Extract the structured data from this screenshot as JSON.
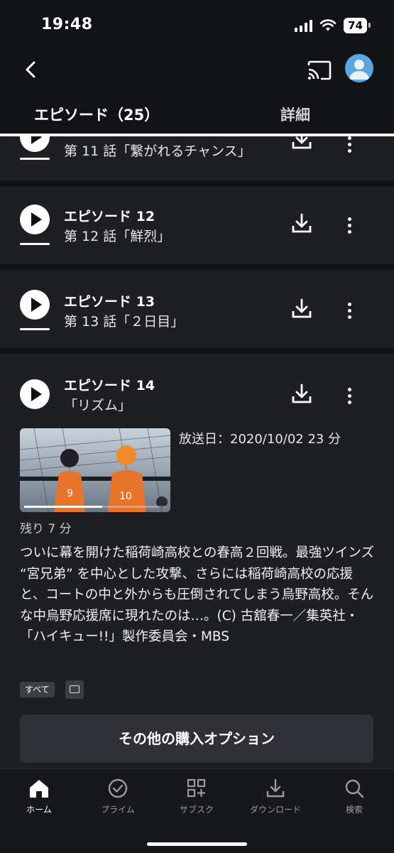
{
  "status_bar": {
    "time": "19:48",
    "battery": "74"
  },
  "tabs": [
    {
      "label": "エピソード（25）",
      "active": true
    },
    {
      "label": "詳細",
      "active": false
    }
  ],
  "episodes": [
    {
      "title": "",
      "subtitle": "第 11 話「繋がれるチャンス」"
    },
    {
      "title": "エピソード 12",
      "subtitle": "第 12 話「鮮烈」"
    },
    {
      "title": "エピソード 13",
      "subtitle": "第 13 話「２日目」"
    },
    {
      "title": "エピソード 14",
      "subtitle": "「リズム」"
    }
  ],
  "expanded": {
    "air_date": "放送日：2020/10/02 23 分",
    "remaining": "残り 7 分",
    "watched_fraction": 0.55,
    "description": "ついに幕を開けた稲荷崎高校との春高２回戦。最強ツインズ “宮兄弟” を中心とした攻撃、さらには稲荷崎高校の応援と、コートの中と外からも圧倒されてしまう烏野高校。そんな中烏野応援席に現れたのは…。(C) 古舘春一／集英社・「ハイキュー!!」製作委員会・MBS",
    "tag_all": "すべて",
    "buy_button": "その他の購入オプション"
  },
  "bottom_nav": [
    {
      "label": "ホーム",
      "icon": "home-icon",
      "active": true
    },
    {
      "label": "プライム",
      "icon": "check-circle-icon",
      "active": false
    },
    {
      "label": "サブスク",
      "icon": "subscriptions-icon",
      "active": false
    },
    {
      "label": "ダウンロード",
      "icon": "download-icon",
      "active": false
    },
    {
      "label": "検索",
      "icon": "search-icon",
      "active": false
    }
  ],
  "colors": {
    "background": "#121316",
    "card": "#1e1f23",
    "accent": "#ffffff"
  }
}
